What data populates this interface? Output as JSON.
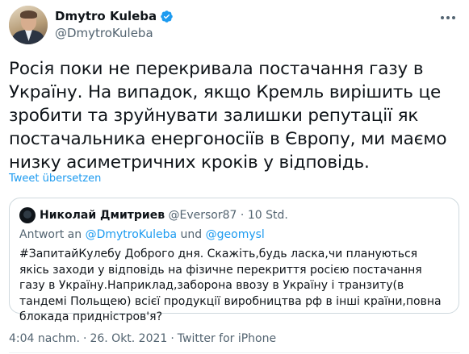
{
  "author": {
    "display_name": "Dmytro Kuleba",
    "handle": "@DmytroKuleba",
    "verified": true
  },
  "tweet": {
    "text": "Росія поки не перекривала постачання газу в Україну. На випадок, якщо Кремль вирішить це зробити та зруйнувати залишки репутації як постачальника енергоносіїв в Європу, ми маємо низку асиметричних кроків у відповідь.",
    "translate_label": "Tweet übersetzen"
  },
  "quoted_tweet": {
    "display_name": "Николай Дмитриев",
    "handle": "@Eversor87",
    "time_ago": "10 Std.",
    "reply_prefix": "Antwort an",
    "reply_to_1": "@DmytroKuleba",
    "reply_join": "und",
    "reply_to_2": "@geomysl",
    "text": "#ЗапитайКулебу Доброго дня. Скажіть,будь ласка,чи плануються якісь заходи у відповідь на фізичне перекриття росією постачання газу в Україну.Наприклад,заборона ввозу в Україну і транзиту(в тандемі Польщею) всієї продукції виробництва рф в інші країни,повна блокада придністров'я?"
  },
  "meta": {
    "time": "4:04 nachm.",
    "date": "26. Okt. 2021",
    "source": "Twitter for iPhone"
  },
  "colors": {
    "accent": "#1d9bf0",
    "text": "#0f1419",
    "secondary": "#536471",
    "border": "#cfd9de"
  }
}
